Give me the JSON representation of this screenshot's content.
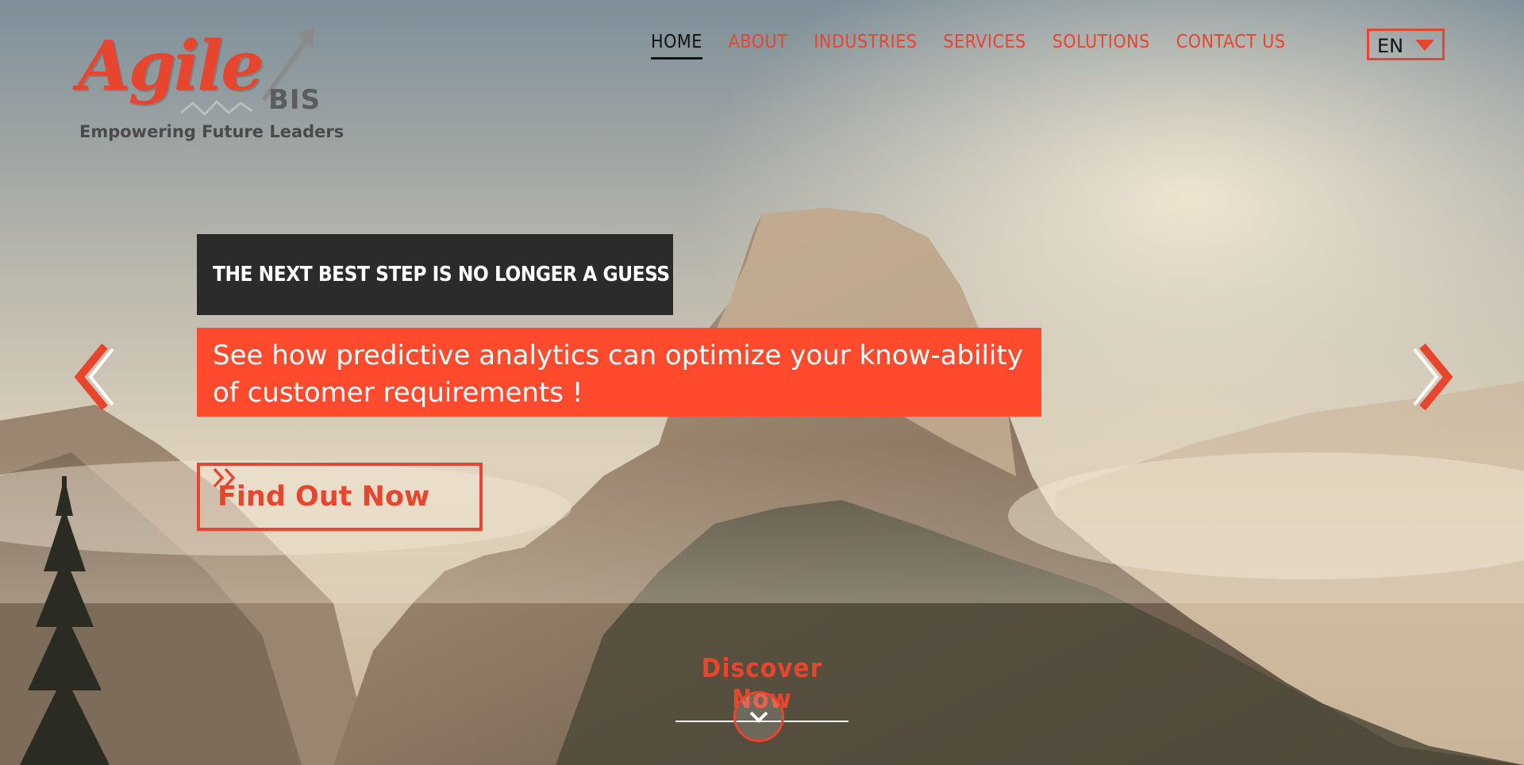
{
  "brand": {
    "logo_word": "Agile",
    "logo_sub": "BIS",
    "tagline": "Empowering Future Leaders"
  },
  "nav": {
    "items": [
      {
        "label": "HOME",
        "active": true
      },
      {
        "label": "ABOUT",
        "active": false
      },
      {
        "label": "INDUSTRIES",
        "active": false
      },
      {
        "label": "SERVICES",
        "active": false
      },
      {
        "label": "SOLUTIONS",
        "active": false
      },
      {
        "label": "CONTACT US",
        "active": false
      }
    ],
    "language": {
      "selected": "EN",
      "icon": "caret-down-icon"
    }
  },
  "slide": {
    "headline": "THE NEXT BEST STEP IS NO LONGER A GUESS",
    "subtext": "See how predictive analytics can optimize your know-ability of customer requirements !",
    "cta_label": "Find Out Now",
    "cta_icon": "double-chevron-right-icon",
    "prev_icon": "chevron-left-icon",
    "next_icon": "chevron-right-icon"
  },
  "discover": {
    "label": "Discover Now",
    "icon": "chevron-down-icon"
  },
  "colors": {
    "accent": "#e8452f",
    "headline_bg": "#2b2b2b",
    "subtext_bg": "#ff4a2e"
  }
}
